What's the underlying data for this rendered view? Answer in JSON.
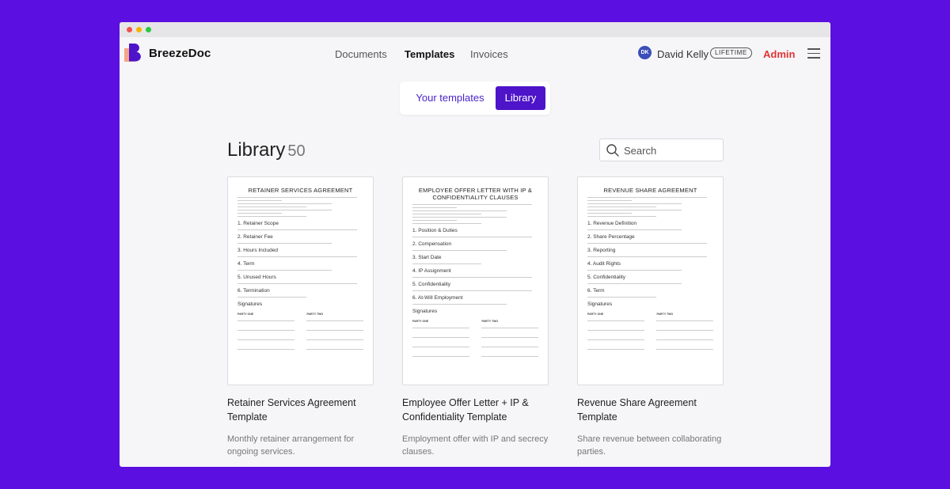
{
  "app": {
    "brand": "BreezeDoc"
  },
  "nav": {
    "documents": "Documents",
    "templates": "Templates",
    "invoices": "Invoices"
  },
  "user": {
    "initials": "DK",
    "name": "David Kelly",
    "plan_badge": "LIFETIME",
    "admin_label": "Admin"
  },
  "tabs": {
    "your_templates": "Your templates",
    "library": "Library",
    "active": "Library"
  },
  "library": {
    "title": "Library",
    "count": "50",
    "search_placeholder": "Search"
  },
  "cards": [
    {
      "doc_title": "RETAINER SERVICES AGREEMENT",
      "sections": [
        "1. Retainer Scope",
        "2. Retainer Fee",
        "3. Hours Included",
        "4. Term",
        "5. Unused Hours",
        "6. Termination",
        "Signatures"
      ],
      "title": "Retainer Services Agreement Template",
      "description": "Monthly retainer arrangement for ongoing services."
    },
    {
      "doc_title": "EMPLOYEE OFFER LETTER WITH IP & CONFIDENTIALITY CLAUSES",
      "sections": [
        "1. Position & Duties",
        "2. Compensation",
        "3. Start Date",
        "4. IP Assignment",
        "5. Confidentiality",
        "6. At-Will Employment",
        "Signatures"
      ],
      "title": "Employee Offer Letter + IP & Confidentiality Template",
      "description": "Employment offer with IP and secrecy clauses."
    },
    {
      "doc_title": "REVENUE SHARE AGREEMENT",
      "sections": [
        "1. Revenue Definition",
        "2. Share Percentage",
        "3. Reporting",
        "4. Audit Rights",
        "5. Confidentiality",
        "6. Term",
        "Signatures"
      ],
      "title": "Revenue Share Agreement Template",
      "description": "Share revenue between collaborating parties."
    }
  ],
  "signature_labels": {
    "party_one": "PARTY ONE",
    "party_two": "PARTY TWO"
  },
  "colors": {
    "background": "#5b0fe0",
    "accent": "#4d14c9",
    "admin": "#e03535",
    "avatar": "#3a4fb8"
  }
}
